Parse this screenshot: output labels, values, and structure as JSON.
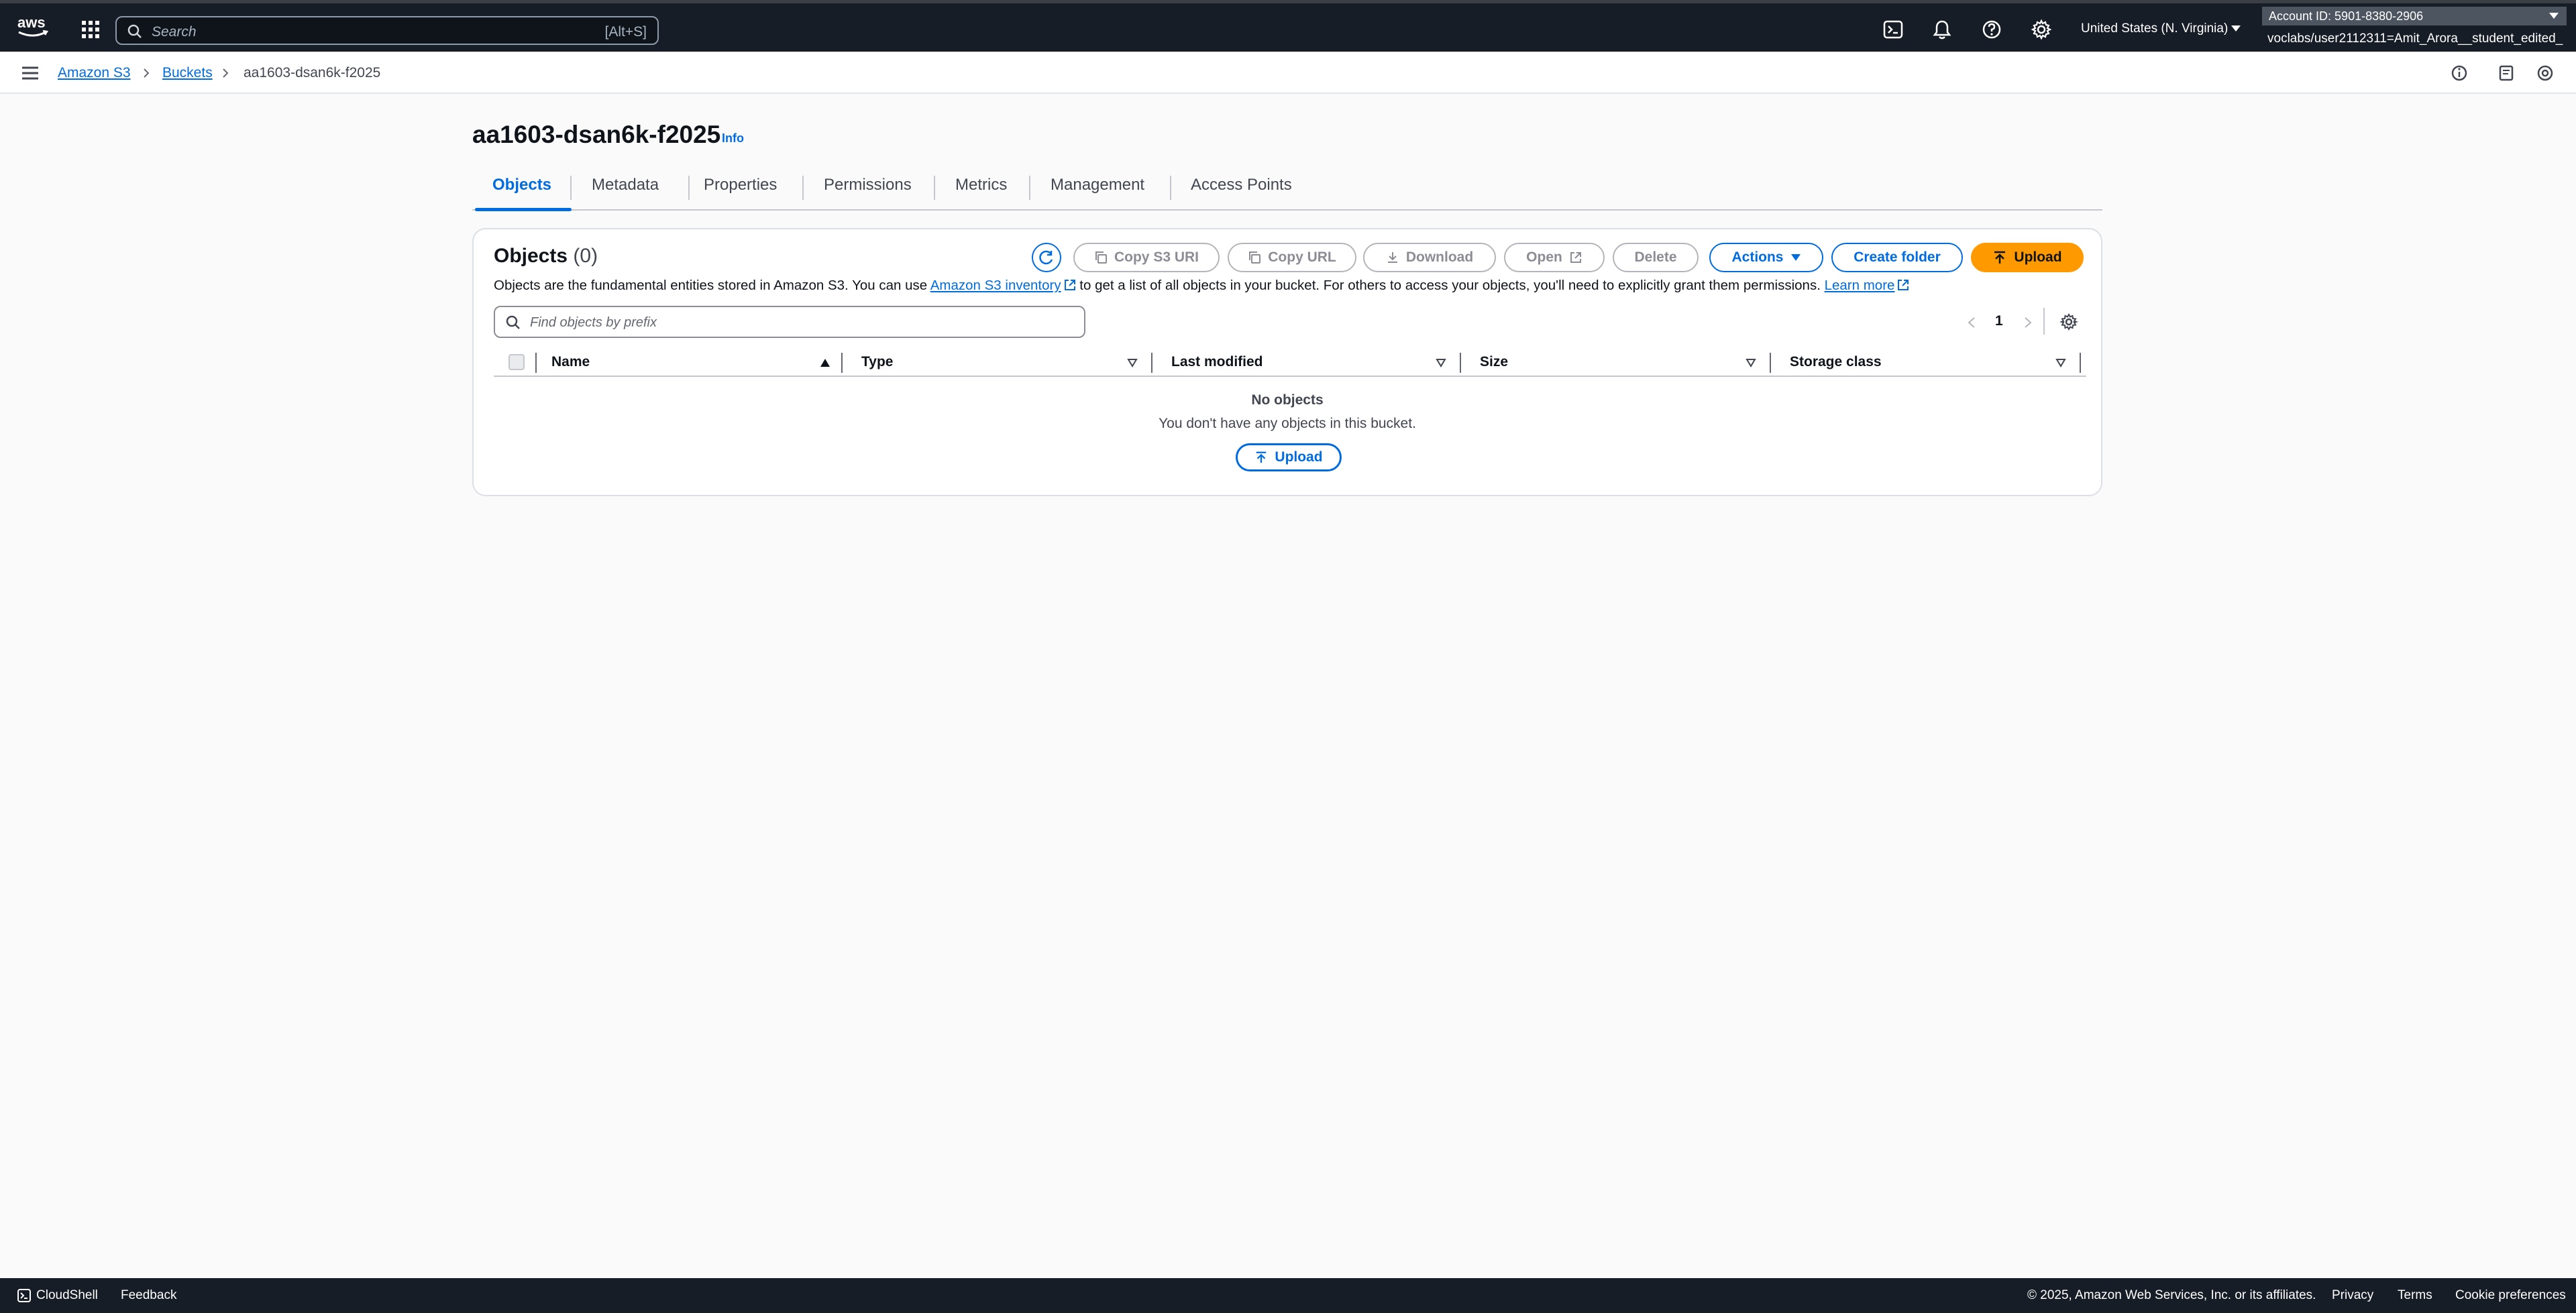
{
  "topnav": {
    "logo_text": "aws",
    "search_placeholder": "Search",
    "search_shortcut": "[Alt+S]",
    "region": "United States (N. Virginia)",
    "account_id": "Account ID: 5901-8380-2906",
    "account_user": "voclabs/user2112311=Amit_Arora__student_edited_"
  },
  "breadcrumb": {
    "items": [
      "Amazon S3",
      "Buckets",
      "aa1603-dsan6k-f2025"
    ]
  },
  "page": {
    "title": "aa1603-dsan6k-f2025",
    "info": "Info"
  },
  "tabs": [
    "Objects",
    "Metadata",
    "Properties",
    "Permissions",
    "Metrics",
    "Management",
    "Access Points"
  ],
  "objects_panel": {
    "title": "Objects",
    "count": "(0)",
    "buttons": {
      "copy_s3_uri": "Copy S3 URI",
      "copy_url": "Copy URL",
      "download": "Download",
      "open": "Open",
      "delete": "Delete",
      "actions": "Actions",
      "create_folder": "Create folder",
      "upload": "Upload"
    },
    "description": {
      "part1": "Objects are the fundamental entities stored in Amazon S3. You can use ",
      "link1": "Amazon S3 inventory",
      "part2": " to get a list of all objects in your bucket. For others to access your objects, you'll need to explicitly grant them permissions. ",
      "link2": "Learn more"
    },
    "filter_placeholder": "Find objects by prefix",
    "page_number": "1",
    "columns": [
      "Name",
      "Type",
      "Last modified",
      "Size",
      "Storage class"
    ],
    "empty_title": "No objects",
    "empty_subtitle": "You don't have any objects in this bucket.",
    "empty_upload": "Upload"
  },
  "footer": {
    "cloudshell": "CloudShell",
    "feedback": "Feedback",
    "copyright": "© 2025, Amazon Web Services, Inc. or its affiliates.",
    "privacy": "Privacy",
    "terms": "Terms",
    "cookies": "Cookie preferences"
  },
  "colors": {
    "nav_bg": "#161d26",
    "link_blue": "#006ce0",
    "upload_orange": "#ff9900"
  }
}
